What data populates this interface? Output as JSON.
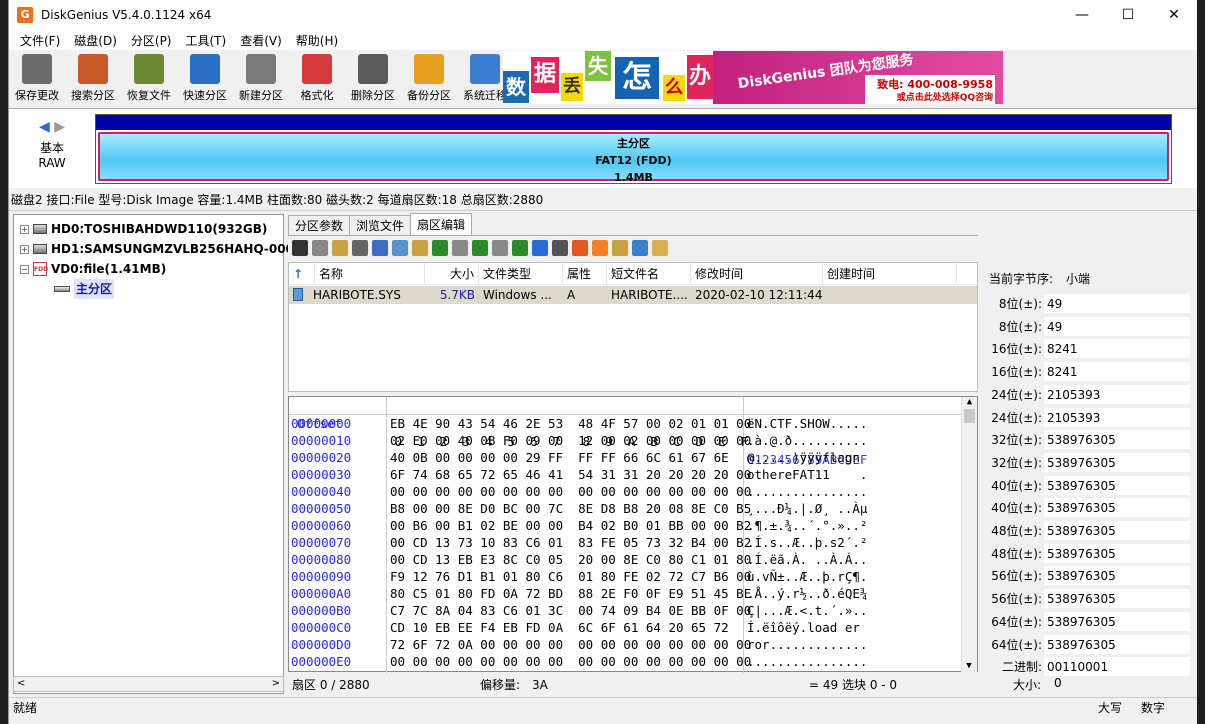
{
  "window": {
    "title": "DiskGenius V5.4.0.1124 x64",
    "app_icon": "G",
    "minimize": "—",
    "maximize": "☐",
    "close": "✕"
  },
  "menu": [
    "文件(F)",
    "磁盘(D)",
    "分区(P)",
    "工具(T)",
    "查看(V)",
    "帮助(H)"
  ],
  "toolbar": [
    {
      "label": "保存更改",
      "icon": "save-disk-icon",
      "color": "#6b6b6b"
    },
    {
      "label": "搜索分区",
      "icon": "magnifier-icon",
      "color": "#c85a2a"
    },
    {
      "label": "恢复文件",
      "icon": "recover-files-icon",
      "color": "#6b8a2f"
    },
    {
      "label": "快速分区",
      "icon": "quick-partition-icon",
      "color": "#2b6fc4"
    },
    {
      "label": "新建分区",
      "icon": "new-partition-icon",
      "color": "#7a7a7a"
    },
    {
      "label": "格式化",
      "icon": "format-lifebuoy-icon",
      "color": "#d63a3a"
    },
    {
      "label": "删除分区",
      "icon": "trash-icon",
      "color": "#5b5b5b"
    },
    {
      "label": "备份分区",
      "icon": "backup-pie-icon",
      "color": "#e8a020"
    },
    {
      "label": "系统迁移",
      "icon": "migrate-monitor-icon",
      "color": "#3a7fd0"
    }
  ],
  "banner": {
    "chars": [
      "数",
      "据",
      "丢",
      "失",
      "怎",
      "么",
      "办"
    ],
    "slogan": "DiskGenius 团队为您服务",
    "phone": "致电: 400-008-9958",
    "qq": "或点击此处选择QQ咨询"
  },
  "diskmap": {
    "basic": "基本",
    "raw": "RAW",
    "partition_name": "主分区",
    "partition_fs": "FAT12 (FDD)",
    "partition_size": "1.4MB"
  },
  "diskinfo": "磁盘2 接口:File  型号:Disk Image  容量:1.4MB  柱面数:80  磁头数:2  每道扇区数:18  总扇区数:2880",
  "tree": [
    {
      "label": "HD0:TOSHIBAHDWD110(932GB)",
      "toggle": "+"
    },
    {
      "label": "HD1:SAMSUNGMZVLB256HAHQ-000",
      "toggle": "+"
    },
    {
      "label": "VD0:file(1.41MB)",
      "toggle": "−",
      "icon_text": "FDD"
    },
    {
      "label": "主分区"
    }
  ],
  "tabs": [
    "分区参数",
    "浏览文件",
    "扇区编辑"
  ],
  "filelist": {
    "headers": [
      "名称",
      "大小",
      "文件类型",
      "属性",
      "短文件名",
      "修改时间",
      "创建时间"
    ],
    "rows": [
      {
        "name": "HARIBOTE.SYS",
        "size": "5.7KB",
        "type": "Windows ...",
        "attr": "A",
        "short": "HARIBOTE....",
        "mtime": "2020-02-10 12:11:44",
        "ctime": ""
      }
    ]
  },
  "hex": {
    "header_offset": "Offset",
    "header_bytes": " 0  1  2  3  4  5  6  7   8  9  A  B  C  D  E  F",
    "header_ascii": "0123456789ABCDEF",
    "rows": [
      {
        "off": "00000000",
        "bytes": "EB 4E 90 43 54 46 2E 53  48 4F 57 00 02 01 01 00",
        "ascii": "ëN.CTF.SHOW....."
      },
      {
        "off": "00000010",
        "bytes": "02 E0 00 40 0B F0 09 00  12 00 02 00 00 00 00 00",
        "ascii": ".à.@.ð.........."
      },
      {
        "off": "00000020",
        "bytes": "40 0B 00 00 00 00 29 FF  FF FF 66 6C 61 67 6E",
        "ascii": "@.....)ÿÿÿflagn"
      },
      {
        "off": "00000030",
        "bytes": "6F 74 68 65 72 65 46 41  54 31 31 20 20 20 20 00",
        "ascii": "othereFAT11    ."
      },
      {
        "off": "00000040",
        "bytes": "00 00 00 00 00 00 00 00  00 00 00 00 00 00 00 00",
        "ascii": "................"
      },
      {
        "off": "00000050",
        "bytes": "B8 00 00 8E D0 BC 00 7C  8E D8 B8 20 08 8E C0 B5",
        "ascii": "¸...Ð¼.|.Ø¸ ..Àµ"
      },
      {
        "off": "00000060",
        "bytes": "00 B6 00 B1 02 BE 00 00  B4 02 B0 01 BB 00 00 B2",
        "ascii": ".¶.±.¾..´.°.»..²"
      },
      {
        "off": "00000070",
        "bytes": "00 CD 13 73 10 83 C6 01  83 FE 05 73 32 B4 00 B2",
        "ascii": ".Í.s..Æ..þ.s2´.²"
      },
      {
        "off": "00000080",
        "bytes": "00 CD 13 EB E3 8C C0 05  20 00 8E C0 80 C1 01 80",
        "ascii": ".Í.ëã.À. ..À.Á.."
      },
      {
        "off": "00000090",
        "bytes": "F9 12 76 D1 B1 01 80 C6  01 80 FE 02 72 C7 B6 00",
        "ascii": "ù.vÑ±..Æ..þ.rÇ¶."
      },
      {
        "off": "000000A0",
        "bytes": "80 C5 01 80 FD 0A 72 BD  88 2E F0 0F E9 51 45 BE",
        "ascii": ".Å..ý.r½..ð.éQE¾"
      },
      {
        "off": "000000B0",
        "bytes": "C7 7C 8A 04 83 C6 01 3C  00 74 09 B4 0E BB 0F 00",
        "ascii": "Ç|...Æ.<.t.´.».."
      },
      {
        "off": "000000C0",
        "bytes": "CD 10 EB EE F4 EB FD 0A  6C 6F 61 64 20 65 72",
        "ascii": "Í.ëîôëý.load er"
      },
      {
        "off": "000000D0",
        "bytes": "72 6F 72 0A 00 00 00 00  00 00 00 00 00 00 00 00",
        "ascii": "ror............."
      },
      {
        "off": "000000E0",
        "bytes": "00 00 00 00 00 00 00 00  00 00 00 00 00 00 00 00",
        "ascii": "................"
      }
    ]
  },
  "sector_status": {
    "sector": "扇区 0 / 2880",
    "offset_label": "偏移量:",
    "offset_value": "3A",
    "eq": "= 49",
    "selection": "选块 0 - 0"
  },
  "inspector": {
    "byte_order_label": "当前字节序:",
    "byte_order_value": "小端",
    "rows": [
      {
        "label": "8位(±):",
        "value": "49"
      },
      {
        "label": "8位(±):",
        "value": "49"
      },
      {
        "label": "16位(±):",
        "value": "8241"
      },
      {
        "label": "16位(±):",
        "value": "8241"
      },
      {
        "label": "24位(±):",
        "value": "2105393"
      },
      {
        "label": "24位(±):",
        "value": "2105393"
      },
      {
        "label": "32位(±):",
        "value": "538976305"
      },
      {
        "label": "32位(±):",
        "value": "538976305"
      },
      {
        "label": "40位(±):",
        "value": "538976305"
      },
      {
        "label": "40位(±):",
        "value": "538976305"
      },
      {
        "label": "48位(±):",
        "value": "538976305"
      },
      {
        "label": "48位(±):",
        "value": "538976305"
      },
      {
        "label": "56位(±):",
        "value": "538976305"
      },
      {
        "label": "56位(±):",
        "value": "538976305"
      },
      {
        "label": "64位(±):",
        "value": "538976305"
      },
      {
        "label": "64位(±):",
        "value": "538976305"
      },
      {
        "label": "二进制:",
        "value": "00110001"
      }
    ],
    "size_label": "大小:",
    "size_value": "0"
  },
  "statusbar": {
    "ready": "就绪",
    "caps": "大写",
    "num": "数字"
  }
}
